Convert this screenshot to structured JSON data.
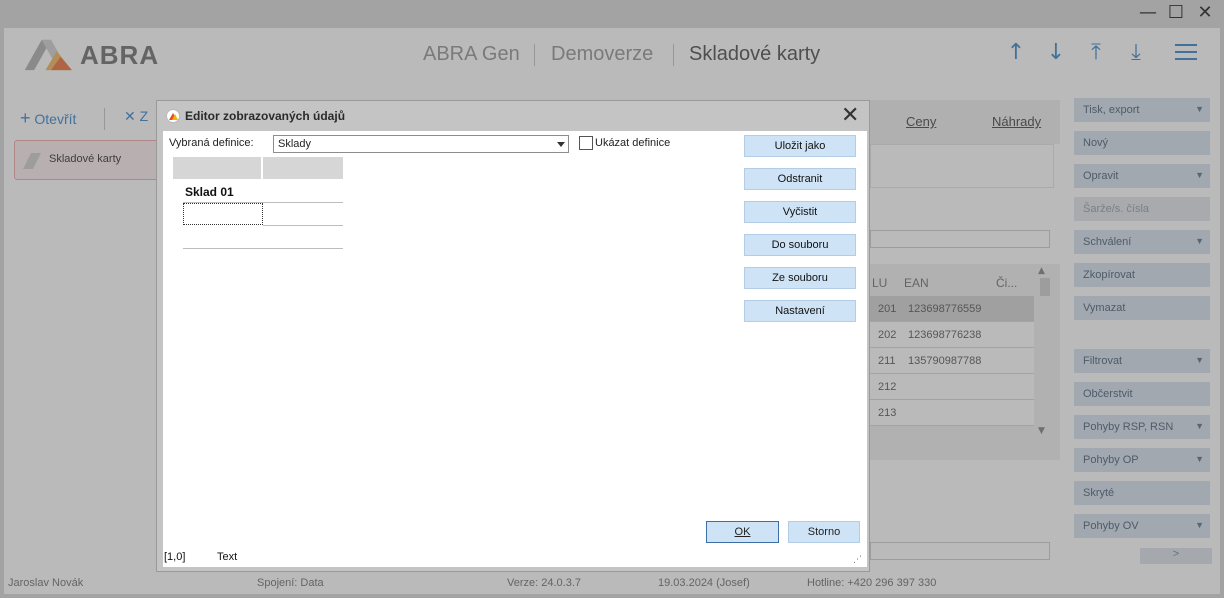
{
  "window": {
    "minimize": "—",
    "maximize": "☐",
    "close": "✕"
  },
  "header": {
    "logo_text": "ABRA",
    "segments": [
      "ABRA Gen",
      "Demoverze",
      "Skladové karty"
    ]
  },
  "toolbar": {
    "open_label": "Otevřít",
    "close_label": "Z"
  },
  "tile": {
    "label": "Skladové karty"
  },
  "tabs": [
    "Ceny",
    "Náhrady"
  ],
  "grid": {
    "headers": [
      "LU",
      "EAN",
      "Či..."
    ],
    "rows": [
      {
        "lu": "201",
        "ean": "123698776559"
      },
      {
        "lu": "202",
        "ean": "123698776238"
      },
      {
        "lu": "211",
        "ean": "135790987788"
      },
      {
        "lu": "212",
        "ean": ""
      },
      {
        "lu": "213",
        "ean": ""
      }
    ]
  },
  "right_buttons": [
    {
      "label": "Tisk, export",
      "dropdown": true,
      "disabled": false
    },
    {
      "label": "Nový",
      "dropdown": false,
      "disabled": false
    },
    {
      "label": "Opravit",
      "dropdown": true,
      "disabled": false
    },
    {
      "label": "Šarže/s. čísla",
      "dropdown": false,
      "disabled": true
    },
    {
      "label": "Schválení",
      "dropdown": true,
      "disabled": false
    },
    {
      "label": "Zkopírovat",
      "dropdown": false,
      "disabled": false
    },
    {
      "label": "Vymazat",
      "dropdown": false,
      "disabled": false
    },
    {
      "label": "Filtrovat",
      "dropdown": true,
      "disabled": false
    },
    {
      "label": "Občerstvit",
      "dropdown": false,
      "disabled": false
    },
    {
      "label": "Pohyby RSP, RSN",
      "dropdown": true,
      "disabled": false
    },
    {
      "label": "Pohyby OP",
      "dropdown": true,
      "disabled": false
    },
    {
      "label": "Skryté",
      "dropdown": false,
      "disabled": false
    },
    {
      "label": "Pohyby OV",
      "dropdown": true,
      "disabled": false
    }
  ],
  "page_next": ">",
  "statusbar": {
    "user": "Jaroslav Novák",
    "connection": "Spojení: Data",
    "version": "Verze: 24.0.3.7",
    "date": "19.03.2024 (Josef)",
    "hotline": "Hotline: +420 296 397 330"
  },
  "dialog": {
    "title": "Editor zobrazovaných údajů",
    "definition_label": "Vybraná definice:",
    "definition_value": "Sklady",
    "show_definitions_label": "Ukázat definice",
    "preview_text": "Sklad 01",
    "buttons": [
      "Uložit jako",
      "Odstranit",
      "Vyčistit",
      "Do souboru",
      "Ze souboru",
      "Nastavení"
    ],
    "ok_label": "OK",
    "cancel_label": "Storno",
    "status_pos": "[1,0]",
    "status_text": "Text"
  }
}
